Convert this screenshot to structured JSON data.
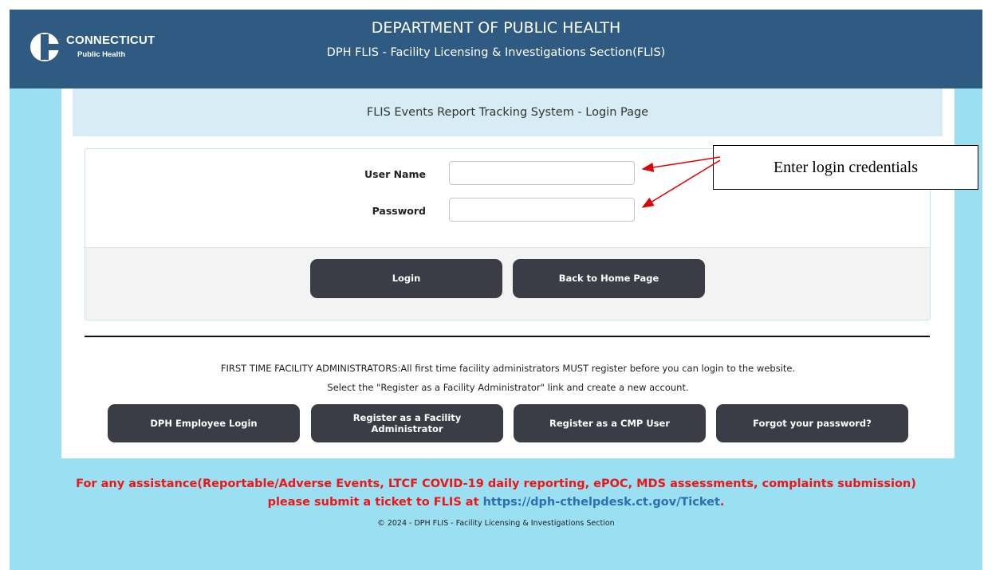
{
  "header": {
    "logo_line1": "CONNECTICUT",
    "logo_line2": "Public Health",
    "title": "DEPARTMENT OF PUBLIC HEALTH",
    "subtitle": "DPH FLIS - Facility Licensing & Investigations Section(FLIS)",
    "color": "#2f5b83"
  },
  "page": {
    "title": "FLIS Events Report Tracking System - Login Page",
    "background": "#9bdff3"
  },
  "login_form": {
    "username_label": "User Name",
    "username_value": "",
    "password_label": "Password",
    "password_value": "",
    "login_button": "Login",
    "home_button": "Back to Home Page"
  },
  "notice": {
    "line1": "FIRST TIME FACILITY ADMINISTRATORS:All first time facility administrators MUST register before you can login to the website.",
    "line2": "Select the \"Register as a Facility Administrator\" link and create a new account."
  },
  "actions": {
    "employee_login": "DPH Employee Login",
    "register_admin": "Register as a Facility Administrator",
    "register_cmp": "Register as a CMP User",
    "forgot_password": "Forgot your password?"
  },
  "assistance": {
    "line1": "For any assistance(Reportable/Adverse Events, LTCF COVID-19 daily reporting, ePOC, MDS assessments, complaints submission)",
    "line2_prefix": "please submit a ticket to FLIS at ",
    "link": "https://dph-cthelpdesk.ct.gov/Ticket",
    "line2_suffix": ".",
    "color": "#ef1515"
  },
  "footer": {
    "copyright": "© 2024 - DPH FLIS - Facility Licensing & Investigations Section"
  },
  "annotation": {
    "callout_text": "Enter login credentials",
    "arrow_color": "#e00000"
  }
}
